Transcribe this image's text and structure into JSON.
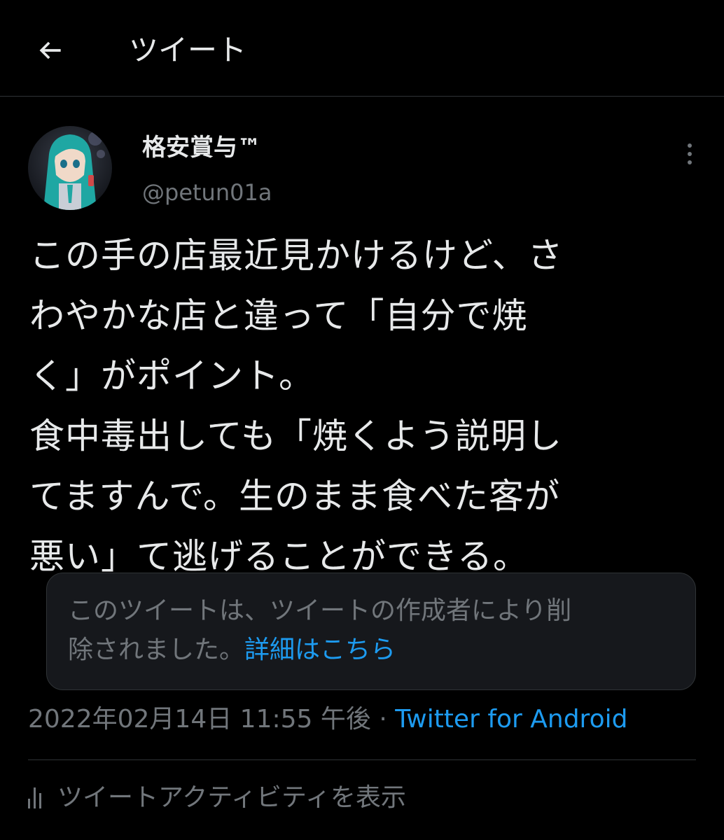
{
  "header": {
    "title": "ツイート"
  },
  "tweet": {
    "display_name": "格安賞与™",
    "handle": "@petun01a",
    "text_lines": [
      "この手の店最近見かけるけど、さ",
      "わやかな店と違って「自分で焼",
      "く」がポイント。",
      "食中毒出しても「焼くよう説明し",
      "てますんで。生のまま食べた客が",
      "悪い」て逃げることができる。"
    ],
    "quoted_notice": {
      "line1": "このツイートは、ツイートの作成者により削",
      "line2": "除されました。",
      "link": "詳細はこちら"
    },
    "timestamp": "2022年02月14日 11:55 午後",
    "separator": " · ",
    "source": "Twitter for Android",
    "activity_label": "ツイートアクティビティを表示"
  },
  "colors": {
    "background": "#000000",
    "text": "#e7e9ea",
    "secondary": "#71767b",
    "accent": "#1d9bf0",
    "border": "#2f3336",
    "card": "#16181c"
  },
  "icons": {
    "back": "arrow-left-icon",
    "more": "more-vertical-icon",
    "activity": "bar-chart-icon"
  }
}
